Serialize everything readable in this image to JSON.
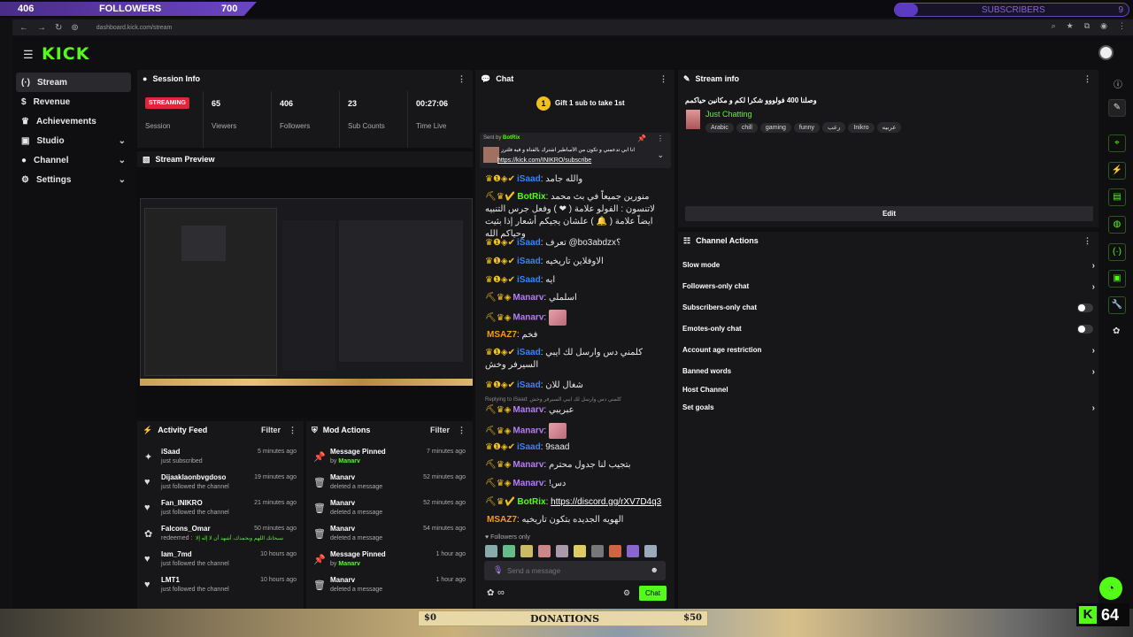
{
  "overlay": {
    "followers_current": "406",
    "followers_label": "FOLLOWERS",
    "followers_goal": "700",
    "subscribers_label": "SUBSCRIBERS",
    "subscribers_count": "9",
    "subscribers_progress": 0.1,
    "donations_left": "$0",
    "donations_label": "DONATIONS",
    "donations_right": "$50",
    "kick_viewers": "64",
    "accent": "#6b45c4"
  },
  "browser": {
    "url": "dashboard.kick.com/stream"
  },
  "brand": {
    "accent": "#53fc18",
    "logo": "KICK"
  },
  "sidebar": {
    "items": [
      {
        "label": "Stream",
        "icon": "broadcast-icon"
      },
      {
        "label": "Revenue",
        "icon": "dollar-icon"
      },
      {
        "label": "Achievements",
        "icon": "trophy-icon"
      },
      {
        "label": "Studio",
        "icon": "studio-icon"
      },
      {
        "label": "Channel",
        "icon": "user-icon"
      },
      {
        "label": "Settings",
        "icon": "gear-icon"
      }
    ]
  },
  "session": {
    "title": "Session Info",
    "status": "STREAMING",
    "session_label": "Session",
    "viewers": "65",
    "viewers_label": "Viewers",
    "followers": "406",
    "followers_label": "Followers",
    "subs": "23",
    "subs_label": "Sub Counts",
    "time": "00:27:06",
    "time_label": "Time Live"
  },
  "preview": {
    "title": "Stream Preview"
  },
  "activity": {
    "title": "Activity Feed",
    "filter": "Filter",
    "rows": [
      {
        "name": "iSaad",
        "desc": "just subscribed",
        "time": "5 minutes ago",
        "icon": "star-icon"
      },
      {
        "name": "Dijaaklaonbvgdoso",
        "desc": "just followed the channel",
        "time": "19 minutes ago",
        "icon": "heart-icon"
      },
      {
        "name": "Fan_INIKRO",
        "desc": "just followed the channel",
        "time": "21 minutes ago",
        "icon": "heart-icon"
      },
      {
        "name": "Falcons_Omar",
        "desc": "redeemed :",
        "desc2": "سبحانك اللهم وبحمدك، أشهد أن لا إله إلا",
        "time": "50 minutes ago",
        "icon": "reward-icon"
      },
      {
        "name": "Iam_7md",
        "desc": "just followed the channel",
        "time": "10 hours ago",
        "icon": "heart-icon"
      },
      {
        "name": "LMT1",
        "desc": "just followed the channel",
        "time": "10 hours ago",
        "icon": "heart-icon"
      }
    ]
  },
  "mod": {
    "title": "Mod Actions",
    "filter": "Filter",
    "rows": [
      {
        "name": "Message Pinned",
        "desc": "by",
        "by": "Manarv",
        "time": "7 minutes ago",
        "icon": "pin-icon"
      },
      {
        "name": "Manarv",
        "desc": "deleted a message",
        "time": "52 minutes ago",
        "icon": "trash-icon"
      },
      {
        "name": "Manarv",
        "desc": "deleted a message",
        "time": "52 minutes ago",
        "icon": "trash-icon"
      },
      {
        "name": "Manarv",
        "desc": "deleted a message",
        "time": "54 minutes ago",
        "icon": "trash-icon"
      },
      {
        "name": "Message Pinned",
        "desc": "by",
        "by": "Manarv",
        "time": "1 hour ago",
        "icon": "pin-icon"
      },
      {
        "name": "Manarv",
        "desc": "deleted a message",
        "time": "1 hour ago",
        "icon": "trash-icon"
      }
    ]
  },
  "chat": {
    "title": "Chat",
    "gift": "Gift 1 sub to take 1st",
    "pinned_sent_by": "Sent by",
    "pinned_user": "BotRix",
    "pinned_text": "انا ابي تدعمني و تكون من الأساطير اشترك بالقناة و فيه فلترز",
    "pinned_link": "https://kick.com/INIKRO/subscribe",
    "messages": [
      {
        "user": "iSaad",
        "cls": "u-isaad",
        "text": "والله جامد"
      },
      {
        "user": "BotRix",
        "cls": "u-botrix",
        "text": "منورين جميعاً في بث محمد لاتنسون : الفولو علامة ( ❤ ) وفعل جرس التنبيه ايضاً علامة ( 🔔 ) علشان يجيكم أشعار إذا بثيت وحياكم الله"
      },
      {
        "user": "iSaad",
        "cls": "u-isaad",
        "text": "تعرف @bo3abdzx؟"
      },
      {
        "user": "iSaad",
        "cls": "u-isaad",
        "text": "الاوفلاين تاريخيه"
      },
      {
        "user": "iSaad",
        "cls": "u-isaad",
        "text": "ايه"
      },
      {
        "user": "Manarv",
        "cls": "u-manarv",
        "text": "اسلملي"
      },
      {
        "user": "Manarv",
        "cls": "u-manarv",
        "text": ""
      },
      {
        "user": "MSAZ7",
        "cls": "u-msaz",
        "text": "فخم"
      },
      {
        "user": "iSaad",
        "cls": "u-isaad",
        "text": "كلمني دس وارسل لك ايبي السيرفر وخش"
      },
      {
        "user": "iSaad",
        "cls": "u-isaad",
        "text": "شغال للان"
      },
      {
        "user": "Manarv",
        "cls": "u-manarv",
        "text": "عبريبي",
        "reply": "Replying to iSaad: كلمني دس وارسل لك ايبي السيرفر وخش"
      },
      {
        "user": "Manarv",
        "cls": "u-manarv",
        "text": ""
      },
      {
        "user": "iSaad",
        "cls": "u-isaad",
        "text": "9saad"
      },
      {
        "user": "Manarv",
        "cls": "u-manarv",
        "text": "بتجيب لنا جدول محترم"
      },
      {
        "user": "Manarv",
        "cls": "u-manarv",
        "text": "!دس"
      },
      {
        "user": "BotRix",
        "cls": "u-botrix",
        "text": "https://discord.gg/rXV7D4q3",
        "link": true
      },
      {
        "user": "MSAZ7",
        "cls": "u-msaz",
        "text": "الهويه الجديده بتكون تاريخيه"
      }
    ],
    "followers_only": "Followers only",
    "placeholder": "Send a message",
    "send_label": "Chat",
    "points": "∞"
  },
  "stream_info": {
    "title": "Stream info",
    "stream_title": "وصلنا 400 فولووو شكرا لكم و مكانين حياكمم",
    "category": "Just Chatting",
    "tags": [
      "Arabic",
      "chill",
      "gaming",
      "funny",
      "رعب",
      "Inikro",
      "عربيه"
    ],
    "edit_label": "Edit"
  },
  "channel_actions": {
    "title": "Channel Actions",
    "items": [
      {
        "label": "Slow mode",
        "type": "chev"
      },
      {
        "label": "Followers-only chat",
        "type": "chev"
      },
      {
        "label": "Subscribers-only chat",
        "type": "toggle"
      },
      {
        "label": "Emotes-only chat",
        "type": "toggle"
      },
      {
        "label": "Account age restriction",
        "type": "chev"
      },
      {
        "label": "Banned words",
        "type": "chev"
      },
      {
        "label": "Host Channel",
        "type": "none"
      },
      {
        "label": "Set goals",
        "type": "chev"
      }
    ]
  }
}
